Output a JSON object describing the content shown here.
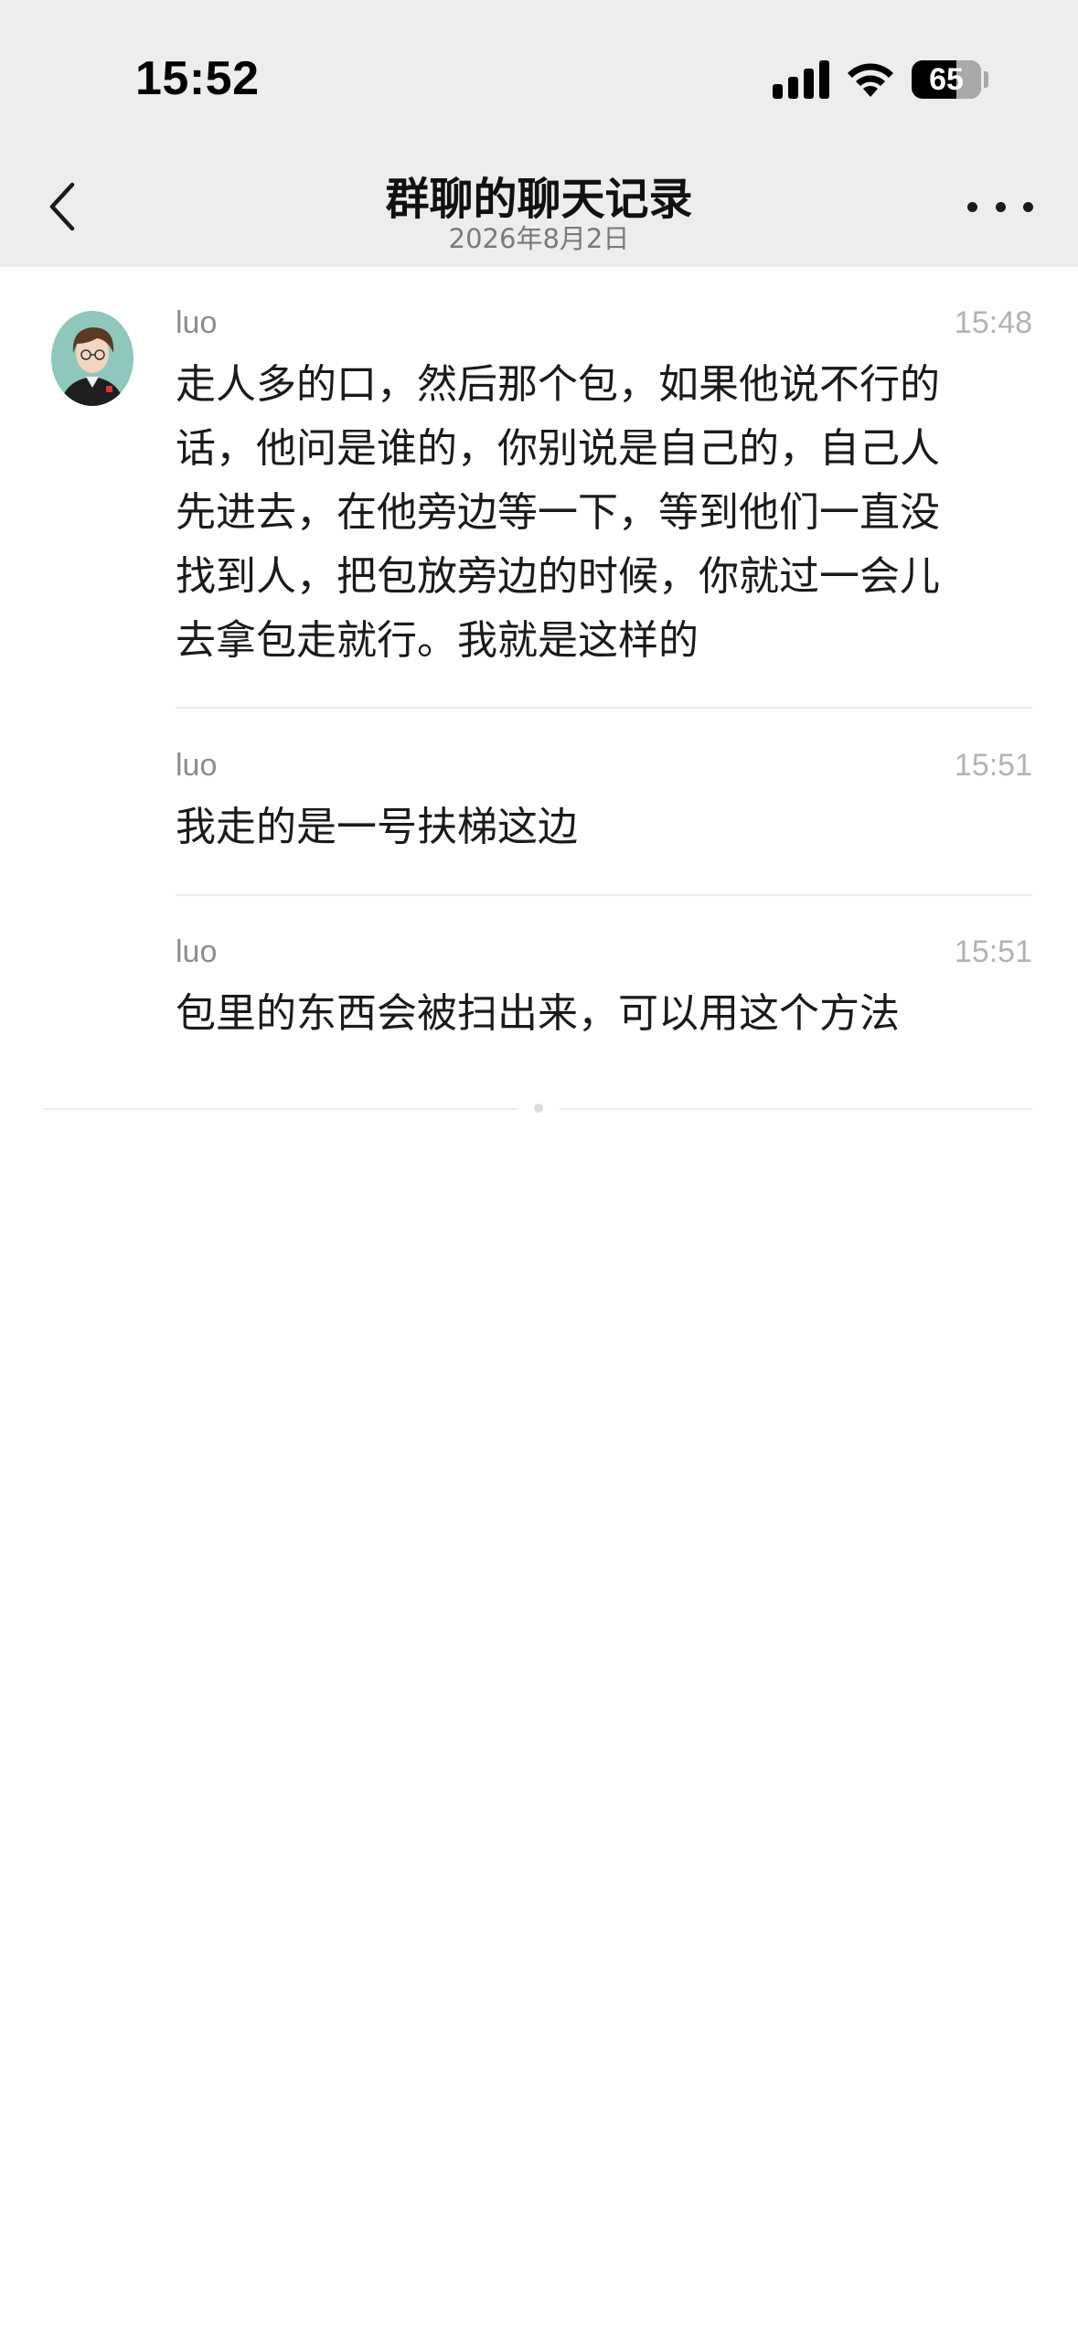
{
  "status_bar": {
    "time": "15:52",
    "battery": "65",
    "battery_level": 0.65
  },
  "nav": {
    "back_icon": "chevron-left-icon",
    "title": "群聊的聊天记录",
    "subtitle": "2026年8月2日",
    "more_icon": "more-icon"
  },
  "messages": [
    {
      "sender": "luo",
      "time": "15:48",
      "lines": [
        "走人多的口，然后那个包，如果他说不行的",
        "话，他问是谁的，你别说是自己的，自己人",
        "先进去，在他旁边等一下，等到他们一直没",
        "找到人，把包放旁边的时候，你就过一会儿",
        "去拿包走就行。我就是这样的"
      ]
    },
    {
      "sender": "luo",
      "time": "15:51",
      "lines": [
        "我走的是一号扶梯这边"
      ]
    },
    {
      "sender": "luo",
      "time": "15:51",
      "lines": [
        "包里的东西会被扫出来，可以用这个方法"
      ]
    }
  ],
  "colors": {
    "header_bg": "#ededed",
    "body_bg": "#ffffff",
    "avatar_bg": "#8fc7bd"
  }
}
